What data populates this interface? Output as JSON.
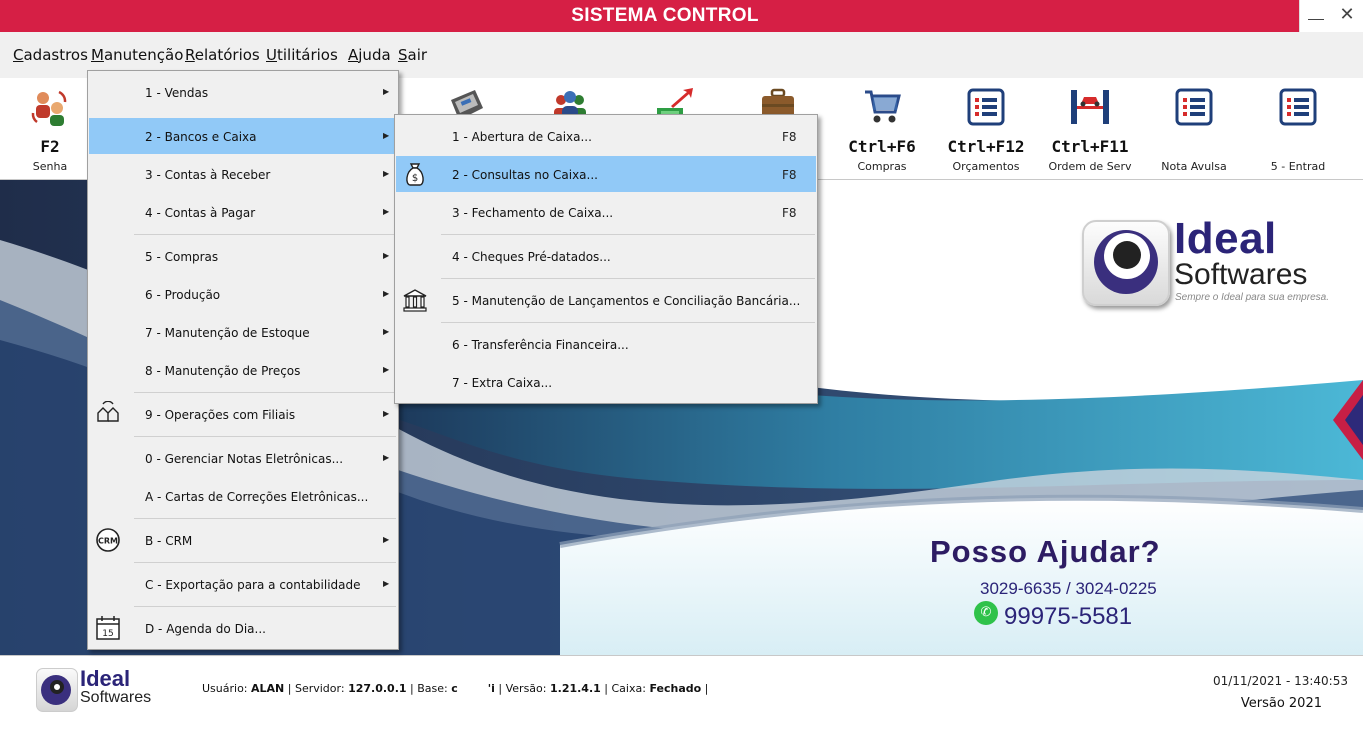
{
  "window": {
    "title": "SISTEMA CONTROL"
  },
  "menubar": [
    {
      "label": "Cadastros",
      "u": "C",
      "rest": "adastros"
    },
    {
      "label": "Manutenção",
      "u": "M",
      "rest": "anutenção"
    },
    {
      "label": "Relatórios",
      "u": "R",
      "rest": "elatórios"
    },
    {
      "label": "Utilitários",
      "u": "U",
      "rest": "tilitários"
    },
    {
      "label": "Ajuda",
      "u": "A",
      "rest": "juda"
    },
    {
      "label": "Sair",
      "u": "S",
      "rest": "air"
    }
  ],
  "toolbar": [
    {
      "key": "F2",
      "label": "Senha",
      "icon": "password-users-icon"
    },
    {
      "key": "",
      "label": "",
      "icon": "cash-register-icon"
    },
    {
      "key": "",
      "label": "",
      "icon": "clients-icon"
    },
    {
      "key": "",
      "label": "",
      "icon": "money-arrow-icon"
    },
    {
      "key": "",
      "label": "",
      "icon": "briefcase-icon"
    },
    {
      "key": "Ctrl+F6",
      "label": "Compras",
      "icon": "shopping-cart-icon"
    },
    {
      "key": "Ctrl+F12",
      "label": "Orçamentos",
      "icon": "list-icon"
    },
    {
      "key": "Ctrl+F11",
      "label": "Ordem de Serv",
      "icon": "car-lift-icon"
    },
    {
      "key": "",
      "label": "Nota Avulsa",
      "icon": "list-icon"
    },
    {
      "key": "",
      "label": "5 - Entrad",
      "icon": "list-icon"
    }
  ],
  "main_menu": [
    {
      "label": "1 - Vendas",
      "submenu": true,
      "icon": ""
    },
    {
      "label": "2 - Bancos e Caixa",
      "submenu": true,
      "icon": "",
      "highlighted": true
    },
    {
      "label": "3 - Contas à Receber",
      "submenu": true,
      "icon": ""
    },
    {
      "label": "4 - Contas à Pagar",
      "submenu": true,
      "icon": ""
    },
    {
      "label": "5 - Compras",
      "submenu": true,
      "icon": ""
    },
    {
      "label": "6 - Produção",
      "submenu": true,
      "icon": ""
    },
    {
      "label": "7 - Manutenção de Estoque",
      "submenu": true,
      "icon": ""
    },
    {
      "label": "8 - Manutenção de Preços",
      "submenu": true,
      "icon": ""
    },
    {
      "label": "9 - Operações com Filiais",
      "submenu": true,
      "icon": "branches-icon"
    },
    {
      "label": "0 - Gerenciar Notas Eletrônicas...",
      "submenu": true,
      "icon": ""
    },
    {
      "label": "A - Cartas de Correções Eletrônicas...",
      "submenu": false,
      "icon": ""
    },
    {
      "label": "B - CRM",
      "submenu": true,
      "icon": "crm-icon",
      "icon_text": "CRM"
    },
    {
      "label": "C - Exportação para a contabilidade",
      "submenu": true,
      "icon": ""
    },
    {
      "label": "D - Agenda do Dia...",
      "submenu": false,
      "icon": "calendar-icon",
      "icon_text": "15"
    }
  ],
  "sub_menu": [
    {
      "label": "1 - Abertura de Caixa...",
      "shortcut": "F8",
      "icon": ""
    },
    {
      "label": "2 - Consultas no Caixa...",
      "shortcut": "F8",
      "icon": "money-bag-icon",
      "highlighted": true
    },
    {
      "label": "3 - Fechamento de Caixa...",
      "shortcut": "F8",
      "icon": ""
    },
    {
      "label": "4 - Cheques Pré-datados...",
      "shortcut": "",
      "icon": ""
    },
    {
      "label": "5 - Manutenção de Lançamentos e Conciliação Bancária...",
      "shortcut": "",
      "icon": "bank-icon"
    },
    {
      "label": "6 - Transferência Financeira...",
      "shortcut": "",
      "icon": ""
    },
    {
      "label": "7 - Extra Caixa...",
      "shortcut": "",
      "icon": ""
    }
  ],
  "brand": {
    "name1": "Ideal",
    "name2": "Softwares",
    "slogan": "Sempre o Ideal para sua empresa."
  },
  "help": {
    "title": "Posso Ajudar?",
    "phones": "3029-6635 / 3024-0225",
    "whatsapp": "99975-5581"
  },
  "status": {
    "user_label": "Usuário:",
    "user": "ALAN",
    "server_label": "| Servidor:",
    "server": "127.0.0.1",
    "base_label": "| Base:",
    "base": "c",
    "base_tail": "'i",
    "version_label": "| Versão:",
    "version": "1.21.4.1",
    "cash_label": "| Caixa:",
    "cash": "Fechado",
    "end": "|",
    "datetime": "01/11/2021 - 13:40:53",
    "product_version": "Versão 2021"
  },
  "colors": {
    "titlebar": "#d61f45",
    "highlight": "#91c9f7",
    "brand": "#2b2478"
  }
}
